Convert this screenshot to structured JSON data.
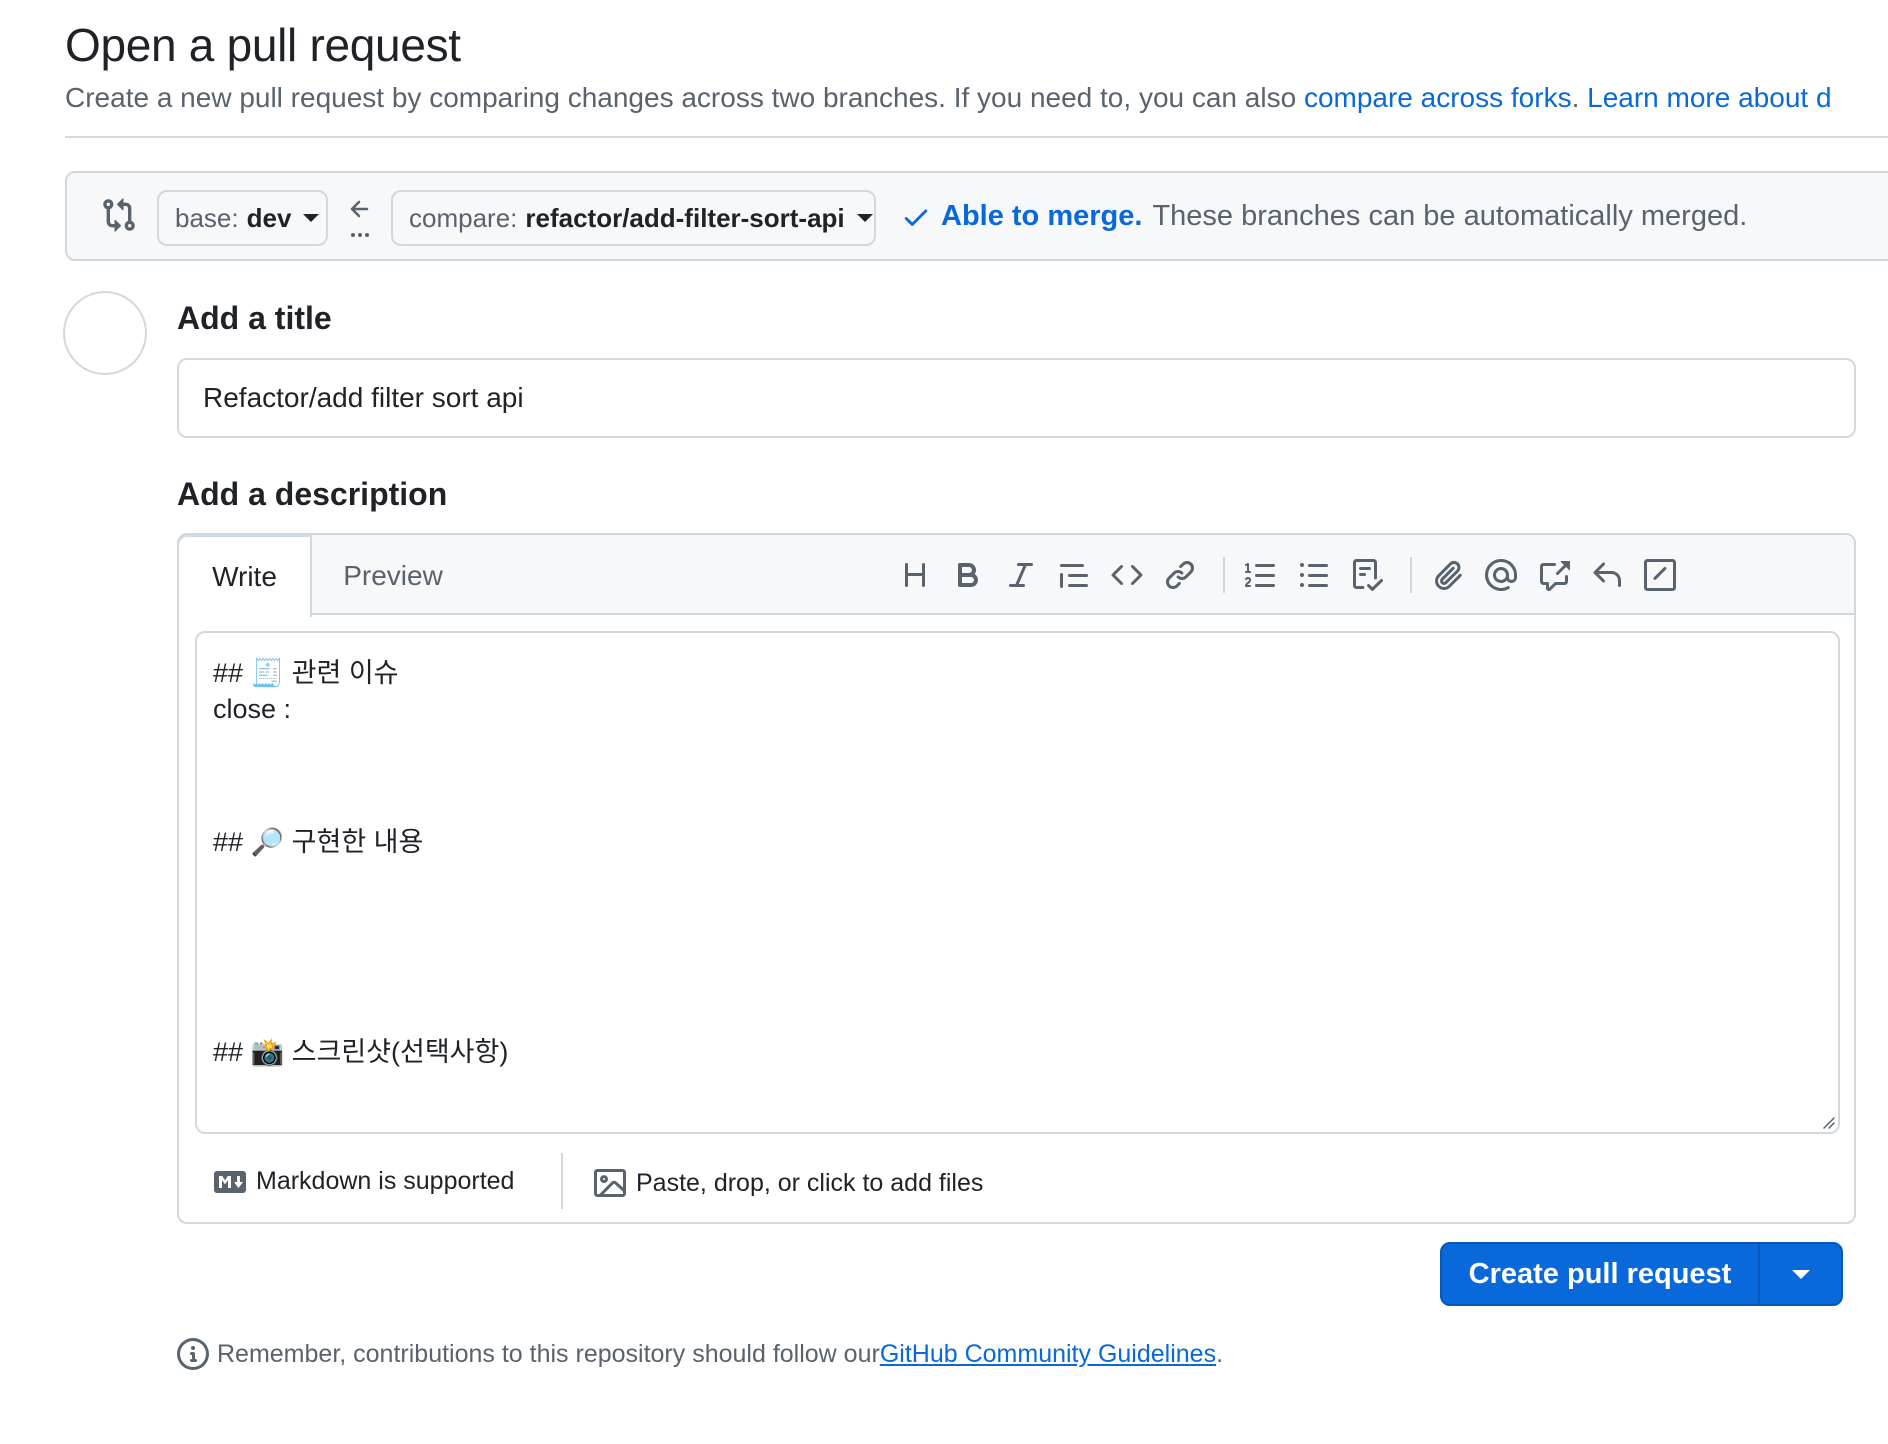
{
  "header": {
    "title": "Open a pull request",
    "subtitle_prefix": "Create a new pull request by comparing changes across two branches. If you need to, you can also ",
    "compare_forks_link": "compare across forks",
    "subtitle_sep": ". ",
    "learn_more_link": "Learn more about d"
  },
  "range": {
    "base_prefix": "base:",
    "base_value": "dev",
    "compare_prefix": "compare:",
    "compare_value": "refactor/add-filter-sort-api",
    "merge_ok": "Able to merge.",
    "merge_text": "These branches can be automatically merged."
  },
  "form": {
    "title_label": "Add a title",
    "title_value": "Refactor/add filter sort api",
    "description_label": "Add a description"
  },
  "editor": {
    "tab_write": "Write",
    "tab_preview": "Preview",
    "toolbar_icons": [
      "heading-icon",
      "bold-icon",
      "italic-icon",
      "quote-icon",
      "code-icon",
      "link-icon",
      "ordered-list-icon",
      "unordered-list-icon",
      "task-list-icon",
      "attach-icon",
      "mention-icon",
      "cross-reference-icon",
      "saved-reply-icon",
      "slash-command-icon"
    ],
    "body_lines": [
      "## 🧾 관련 이슈",
      "close :",
      "## 🔎 구현한 내용",
      "## 📸 스크린샷(선택사항)"
    ],
    "markdown_note": "Markdown is supported",
    "files_note": "Paste, drop, or click to add files"
  },
  "actions": {
    "create_label": "Create pull request"
  },
  "notice": {
    "text": "Remember, contributions to this repository should follow our ",
    "link": "GitHub Community Guidelines",
    "end": "."
  },
  "colors": {
    "accent": "#0969da",
    "border": "#d1d9e0",
    "muted": "#59636e",
    "header_bg": "#f6f8fa"
  }
}
